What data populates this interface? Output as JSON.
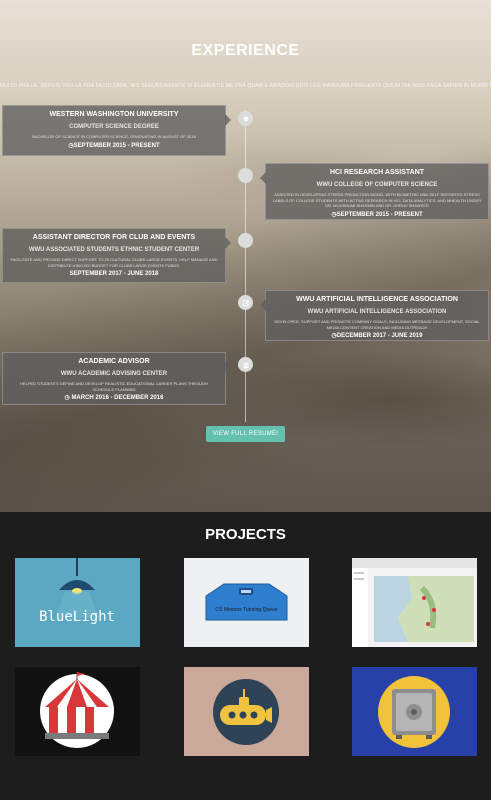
{
  "experience": {
    "title": "EXPERIENCE",
    "subtitle": "MUITO PRA LÁ, DEPOIS VOU LÁ PRA FACULDADE, NIS SEGUNDAMENTE SI ELEMENTIS ME PRA QUAM E AMADOIS QUIS LEO MANDUMA PINGUERTA QUIUM DIA NOIS PAGA SAPIEN IN MORBI PAUPIES",
    "items": [
      {
        "title": "WESTERN WASHINGTON UNIVERSITY",
        "org": "COMPUTER SCIENCE DEGREE",
        "desc": "BACHELOR OF SCIENCE IN COMPUTER SCIENCE, GRADUATING IN AUGUST OF 2018",
        "date": "SEPTEMBER 2015 - PRESENT",
        "icon": "graduation-cap-icon"
      },
      {
        "title": "HCI RESEARCH ASSISTANT",
        "org": "WWU COLLEGE OF COMPUTER SCIENCE",
        "desc": "ASSISTED IN DEVELOPING STRESS PREDICTION MODEL WITH BIOMETRIC AND SELF REPORTED STRESS LABELS OF COLLEGE STUDENTS WITH ACTIVE RESEARCH IN HCI, DATA ANALYTICS, AND MHEALTH UNDER DR. MOUSHUMI SHARMIN AND DR. DHRUV SHAWEED",
        "date": "SEPTEMBER 2015 - PRESENT",
        "icon": "circle-icon"
      },
      {
        "title": "ASSISTANT DIRECTOR FOR CLUB AND EVENTS",
        "org": "WWU ASSOCIATED STUDENTS ETHNIC STUDENT CENTER",
        "desc": "FACILITATE AND PROVIDE DIRECT SUPPORT TO 25 CULTURAL CLUBS LARGE EVENTS. HELP MANAGE AND DISTRIBUTE A $40,000 BUDGET FOR CLUBS LARGE EVENTS FUNDS.",
        "date": "SEPTEMBER 2017 - JUNE 2018",
        "icon": "circle-icon"
      },
      {
        "title": "WWU ARTIFICIAL INTELLIGENCE ASSOCIATION",
        "org": "WWU ARTIFICIAL INTELLIGENCE ASSOCIATION",
        "desc": "DEVELOPED, SUPPORT AND PROMOTE COMPANY GOALS, INCLUDING MESSAGE DEVELOPMENT, SOCIAL MEDIA CONTENT CREATION AND MEDIA OUTREACH",
        "date": "DECEMBER 2017 - JUNE 2019",
        "icon": "edit-icon"
      },
      {
        "title": "ACADEMIC ADVISOR",
        "org": "WWU ACADEMIC ADVISING CENTER",
        "desc": "HELPED STUDENTS DEFINE AND DEVELOP REALISTIC EDUCATIONAL CAREER PLANS THROUGH SCHEDULE PLANNING",
        "date": "MARCH 2016 - DECEMBER 2016",
        "icon": "building-icon"
      }
    ],
    "resume_button": "VIEW FULL RESUMÉ!"
  },
  "projects": {
    "title": "PROJECTS",
    "tiles": [
      {
        "name": "bluelight",
        "label": "BlueLight",
        "colors": {
          "bg": "#5aa8c1",
          "lamp": "#1e4b6e",
          "text": "#ffffff"
        }
      },
      {
        "name": "cs-mentors",
        "label": "CS Mentors Tutoring Queue",
        "colors": {
          "bg": "#eef0f2",
          "accent": "#2f7fd1"
        }
      },
      {
        "name": "map-app",
        "label": "",
        "colors": {
          "bg": "#f3f3f3"
        }
      },
      {
        "name": "circus",
        "label": "",
        "colors": {
          "bg": "#111111",
          "stripe": "#d9383a"
        }
      },
      {
        "name": "submarine",
        "label": "",
        "colors": {
          "bg": "#caa99a",
          "circle": "#2f4356",
          "sub": "#f1c23d"
        }
      },
      {
        "name": "vault",
        "label": "",
        "colors": {
          "bg": "#2741a8",
          "circle": "#f2c23a",
          "safe": "#8e8e8e"
        }
      }
    ]
  }
}
